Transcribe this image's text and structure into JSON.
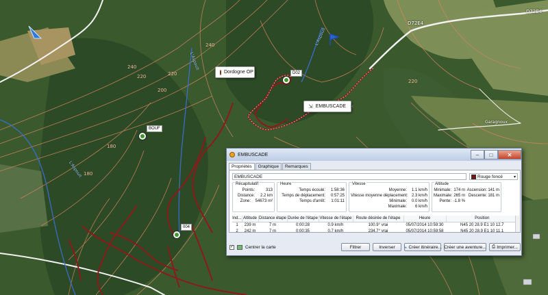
{
  "map": {
    "contour_labels": [
      "240",
      "220",
      "200",
      "220",
      "180",
      "180",
      "240",
      "220"
    ],
    "roads": {
      "d72e4_top": "D72E4",
      "d72e4_mid": "D72E4",
      "place_right": "Garagnoux"
    },
    "rivers": {
      "left": "L'Aspoult",
      "middle": "L'Aspoult",
      "top": "L'Aspoult"
    },
    "callouts": {
      "poi": "Dordogne OP",
      "track": "EMBUSCADE"
    },
    "waypoints": {
      "bouf": "BOUF",
      "d02": "D02",
      "d04": "004"
    },
    "colors": {
      "track": "#8b1a1a",
      "contour": "#d9865f",
      "road": "#ffffff"
    }
  },
  "dialog": {
    "title": "EMBUSCADE",
    "tabs": [
      "Propriétés",
      "Graphique",
      "Remarques"
    ],
    "name_value": "EMBUSCADE",
    "color_name": "Rouge foncé",
    "summary": {
      "title": "Récapitulatif",
      "rows": [
        {
          "k": "Points:",
          "v": "313"
        },
        {
          "k": "Distance:",
          "v": "2.2 km"
        },
        {
          "k": "Zone:",
          "v": "54673 m²"
        }
      ]
    },
    "time": {
      "title": "Heure",
      "rows": [
        {
          "k": "Temps écoulé:",
          "v": "1:58:36"
        },
        {
          "k": "Temps de déplacement:",
          "v": "0:57:25"
        },
        {
          "k": "Temps d'arrêt:",
          "v": "1:01:11"
        }
      ]
    },
    "speed": {
      "title": "Vitesse",
      "rows": [
        {
          "k": "Moyenne:",
          "v": "1.1 km/h"
        },
        {
          "k": "Vitesse moyenne déplacement:",
          "v": "2.3 km/h"
        },
        {
          "k": "Minimale:",
          "v": "0.0 km/h"
        },
        {
          "k": "Maximale:",
          "v": "6 km/h"
        }
      ]
    },
    "altitude": {
      "title": "Altitude",
      "rows": [
        {
          "k": "Minimale:",
          "v": "174 m",
          "k2": "Ascension:",
          "v2": "141 m"
        },
        {
          "k": "Maximale:",
          "v": "265 m",
          "k2": "Descente:",
          "v2": "181 m"
        },
        {
          "k": "Pente:",
          "v": "-1.8 %",
          "k2": "",
          "v2": ""
        }
      ]
    },
    "table": {
      "headers": [
        "Ind...",
        "Altitude",
        "Distance étape",
        "Durée de l'étape",
        "Vitesse de l'étape",
        "Route désirée de l'étape",
        "Heure",
        "Position"
      ],
      "rows": [
        [
          "1",
          "239 m",
          "7 m",
          "0:00:28",
          "0.9 km/h",
          "100.9° vrai",
          "05/07/2014 10:59:30",
          "N45 20 28.9 E1 10 12.7"
        ],
        [
          "2",
          "242 m",
          "7 m",
          "0:00:35",
          "0.7 km/h",
          "234.7° vrai",
          "05/07/2014 10:59:58",
          "N45 20 28.9 E1 10 11.1"
        ]
      ]
    },
    "center_map_label": "Centrer la carte",
    "buttons": {
      "filter": "Filtrer",
      "reverse": "Inverser",
      "create_route": "Créer itinéraire...",
      "create_adventure": "Créer une aventure...",
      "print": "Imprimer..."
    }
  }
}
